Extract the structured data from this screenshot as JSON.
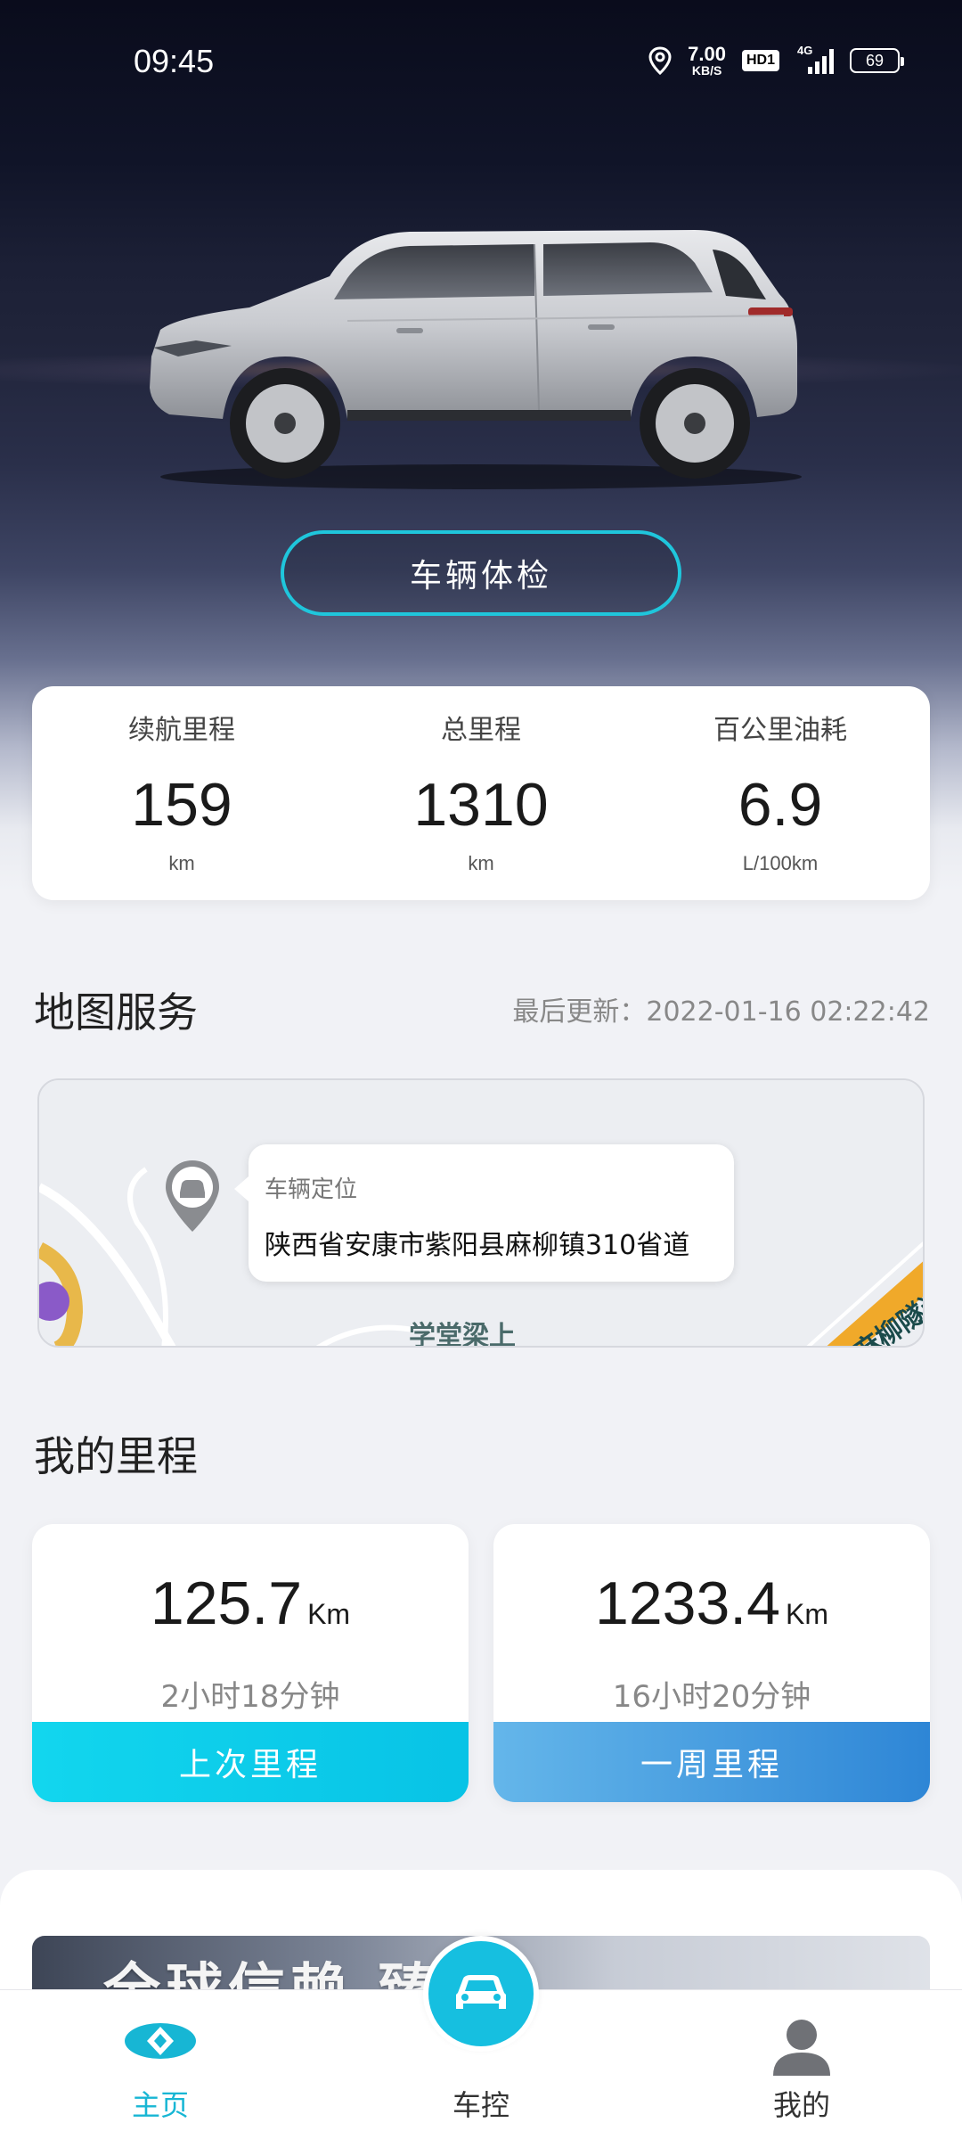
{
  "status_bar": {
    "time": "09:45",
    "net_speed_value": "7.00",
    "net_speed_unit": "KB/S",
    "hd_label": "HD1",
    "network_label": "4G",
    "battery": "69"
  },
  "hero": {
    "check_button": "车辆体检"
  },
  "stats": [
    {
      "title": "续航里程",
      "value": "159",
      "unit": "km"
    },
    {
      "title": "总里程",
      "value": "1310",
      "unit": "km"
    },
    {
      "title": "百公里油耗",
      "value": "6.9",
      "unit": "L/100km"
    }
  ],
  "map_service": {
    "title": "地图服务",
    "last_update": "最后更新：2022-01-16 02:22:42",
    "bubble_title": "车辆定位",
    "address": "陕西省安康市紫阳县麻柳镇310省道",
    "place_label": "学堂梁上",
    "tunnel_label": "麻柳隧道"
  },
  "mileage": {
    "title": "我的里程",
    "cards": [
      {
        "value": "125.7",
        "unit": "Km",
        "duration": "2小时18分钟",
        "label": "上次里程"
      },
      {
        "value": "1233.4",
        "unit": "Km",
        "duration": "16小时20分钟",
        "label": "一周里程"
      }
    ]
  },
  "promo": {
    "banner_text": "全球信赖 臻品"
  },
  "nav": {
    "home": "主页",
    "car_control": "车控",
    "mine": "我的"
  },
  "colors": {
    "accent": "#17b6d4",
    "cyan_bar": "#08c3e6",
    "blue_bar": "#2e86d6"
  }
}
